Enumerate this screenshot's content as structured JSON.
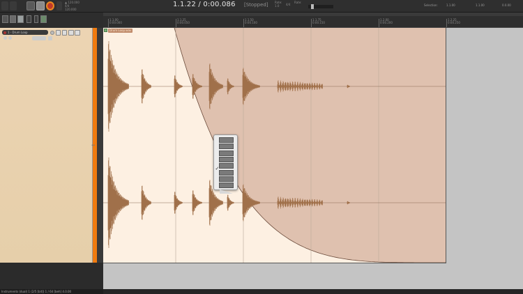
{
  "transport": {
    "time_display": "1.1.22 / 0:00.086",
    "status": "[Stopped]",
    "tempo_lines": [
      "▲ 120.000",
      "4/4",
      "120.000"
    ],
    "rate_lines": [
      "Rate:",
      "1.0"
    ],
    "ratio": "4/4",
    "rate_label": "Rate:",
    "selection_label": "Selection:",
    "selection_start": "1.1.00",
    "selection_end": "1.1.00",
    "selection_length": "0.0.00"
  },
  "track": {
    "name": "1 - Drum Loop",
    "color": "#f07b0f",
    "mute_label": "M",
    "solo_label": "S"
  },
  "ruler": {
    "markers": [
      {
        "bar": "1.1.00",
        "time": "0:00.000"
      },
      {
        "bar": "1.1.25",
        "time": "0:00.050"
      },
      {
        "bar": "1.1.50",
        "time": "0:00.100"
      },
      {
        "bar": "1.1.75",
        "time": "0:00.150"
      },
      {
        "bar": "1.2.00",
        "time": "0:00.200"
      },
      {
        "bar": "1.2.25",
        "time": "0:00.250"
      }
    ]
  },
  "item": {
    "name": "Drum Loop.wav",
    "fade_shape_selected_index": 4
  },
  "fade_menu": {
    "options": [
      "linear",
      "fast-start",
      "fast-end",
      "slow-start-end",
      "logarithmic",
      "exponential",
      "s-curve",
      "sharp"
    ],
    "checkmark": "✓"
  },
  "statusbar": {
    "text": "Instruments (dual) 1 (2/5 [bit]) 1 / 64 [beh] 4.0.00"
  },
  "colors": {
    "item_bg": "#fdf0e2",
    "fade_overlay": "#d9b8a6",
    "waveform": "#a0704a",
    "track_color": "#f07b0f"
  }
}
